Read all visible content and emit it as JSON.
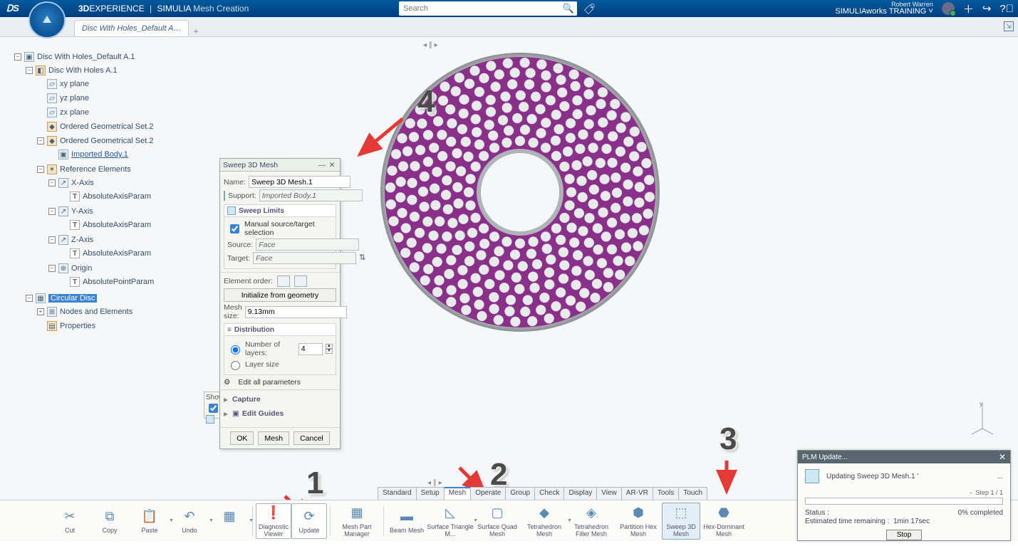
{
  "header": {
    "brand_strong": "3D",
    "brand_rest": "EXPERIENCE",
    "app_vendor": "SIMULIA",
    "app_name": "Mesh Creation",
    "search_placeholder": "Search",
    "user_name": "Robert Warren",
    "role": "SIMULIAworks TRAINING",
    "role_caret": "˅"
  },
  "tabs": {
    "doc": "Disc With Holes_Default A…"
  },
  "tree": {
    "root": "Disc With Holes_Default A.1",
    "n1": "Disc With Holes A.1",
    "xy": "xy plane",
    "yz": "yz plane",
    "zx": "zx plane",
    "ogs2a": "Ordered Geometrical Set.2",
    "ogs2b": "Ordered Geometrical Set.2",
    "imp": "Imported Body.1",
    "ref": "Reference Elements",
    "xaxis": "X-Axis",
    "yaxis": "Y-Axis",
    "zaxis": "Z-Axis",
    "abs": "AbsoluteAxisParam",
    "origin": "Origin",
    "abspt": "AbsolutePointParam",
    "circ": "Circular Disc",
    "nodes": "Nodes and Elements",
    "props": "Properties"
  },
  "dialog": {
    "title": "Sweep 3D Mesh",
    "name_lbl": "Name:",
    "name_val": "Sweep 3D Mesh.1",
    "support_lbl": "Support:",
    "support_val": "Imported Body.1",
    "limits_h": "Sweep Limits",
    "chk_manual": "Manual source/target selection",
    "source_lbl": "Source:",
    "target_lbl": "Target:",
    "face": "Face",
    "eo_lbl": "Element order:",
    "init_btn": "Initialize from geometry",
    "meshsize_lbl": "Mesh size:",
    "meshsize_val": "9.13mm",
    "dist_h": "Distribution",
    "nlayers_lbl": "Number of layers:",
    "nlayers_val": "4",
    "layersize_lbl": "Layer size",
    "editall": "Edit all parameters",
    "capture": "Capture",
    "editguides": "Edit Guides",
    "ok": "OK",
    "mesh": "Mesh",
    "cancel": "Cancel"
  },
  "show_label": "Show",
  "btabs": {
    "standard": "Standard",
    "setup": "Setup",
    "mesh": "Mesh",
    "operate": "Operate",
    "group": "Group",
    "check": "Check",
    "display": "Display",
    "view": "View",
    "arvr": "AR-VR",
    "tools": "Tools",
    "touch": "Touch"
  },
  "toolbar": {
    "cut": "Cut",
    "copy": "Copy",
    "paste": "Paste",
    "undo": "Undo",
    "diag": "Diagnostic Viewer",
    "update": "Update",
    "meshpm": "Mesh Part Manager",
    "beam": "Beam Mesh",
    "surftri": "Surface Triangle M...",
    "surfquad": "Surface Quad Mesh",
    "tetra": "Tetrahedron Mesh",
    "tetfill": "Tetrahedron Filler Mesh",
    "phex": "Partition Hex Mesh",
    "sweep3d": "Sweep 3D Mesh",
    "hexdom": "Hex-Dominant Mesh"
  },
  "plm": {
    "title": "PLM Update...",
    "msg": "Updating Sweep 3D Mesh.1 '",
    "ellipsis": "...",
    "dash": "-",
    "step": "Step 1 / 1",
    "status_lbl": "Status :",
    "status_val": "0% completed",
    "eta_lbl": "Estimated time remaining :",
    "eta_val": "1min 17sec",
    "stop": "Stop"
  },
  "anno": {
    "n1": "1",
    "n2": "2",
    "n3": "3",
    "n4": "4"
  },
  "axis": {
    "y": "y"
  }
}
